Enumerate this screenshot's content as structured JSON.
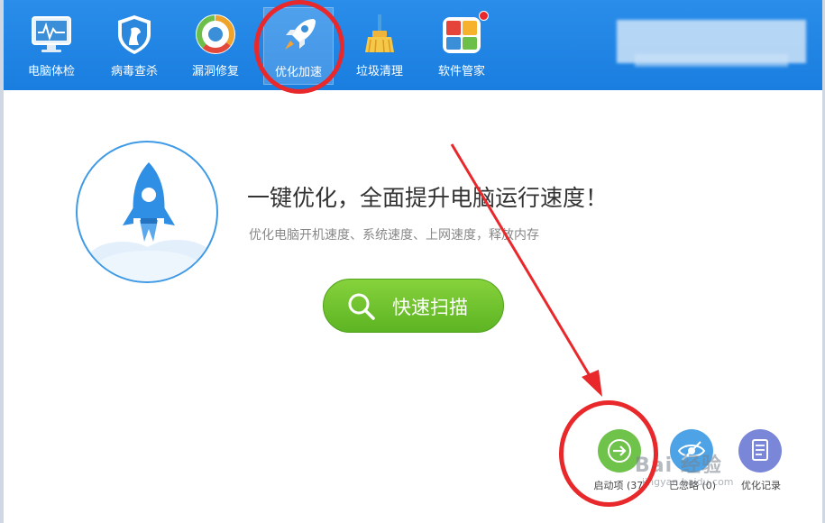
{
  "toolbar": {
    "items": [
      {
        "label": "电脑体检",
        "icon": "monitor-icon"
      },
      {
        "label": "病毒查杀",
        "icon": "shield-horse-icon"
      },
      {
        "label": "漏洞修复",
        "icon": "repair-ring-icon"
      },
      {
        "label": "优化加速",
        "icon": "rocket-icon",
        "active": true
      },
      {
        "label": "垃圾清理",
        "icon": "broom-icon"
      },
      {
        "label": "软件管家",
        "icon": "software-tiles-icon",
        "badge": "notification-dot"
      }
    ]
  },
  "main": {
    "headline": "一键优化，全面提升电脑运行速度！",
    "subline": "优化电脑开机速度、系统速度、上网速度，释放内存",
    "scan_button": {
      "label": "快速扫描",
      "icon": "search-icon"
    }
  },
  "bottom_actions": [
    {
      "label": "启动项 (37)",
      "icon": "arrow-right-icon",
      "color": "#6fc24a"
    },
    {
      "label": "已忽略 (0)",
      "icon": "eye-icon",
      "color": "#4da3e6"
    },
    {
      "label": "优化记录",
      "icon": "document-icon",
      "color": "#7a86d8"
    }
  ],
  "watermark": {
    "text": "Bai 经验",
    "url": "jingyan.baidu.com"
  },
  "colors": {
    "header_blue": "#1a7ee0",
    "accent_green": "#5db423",
    "annotation_red": "#e8282a"
  }
}
